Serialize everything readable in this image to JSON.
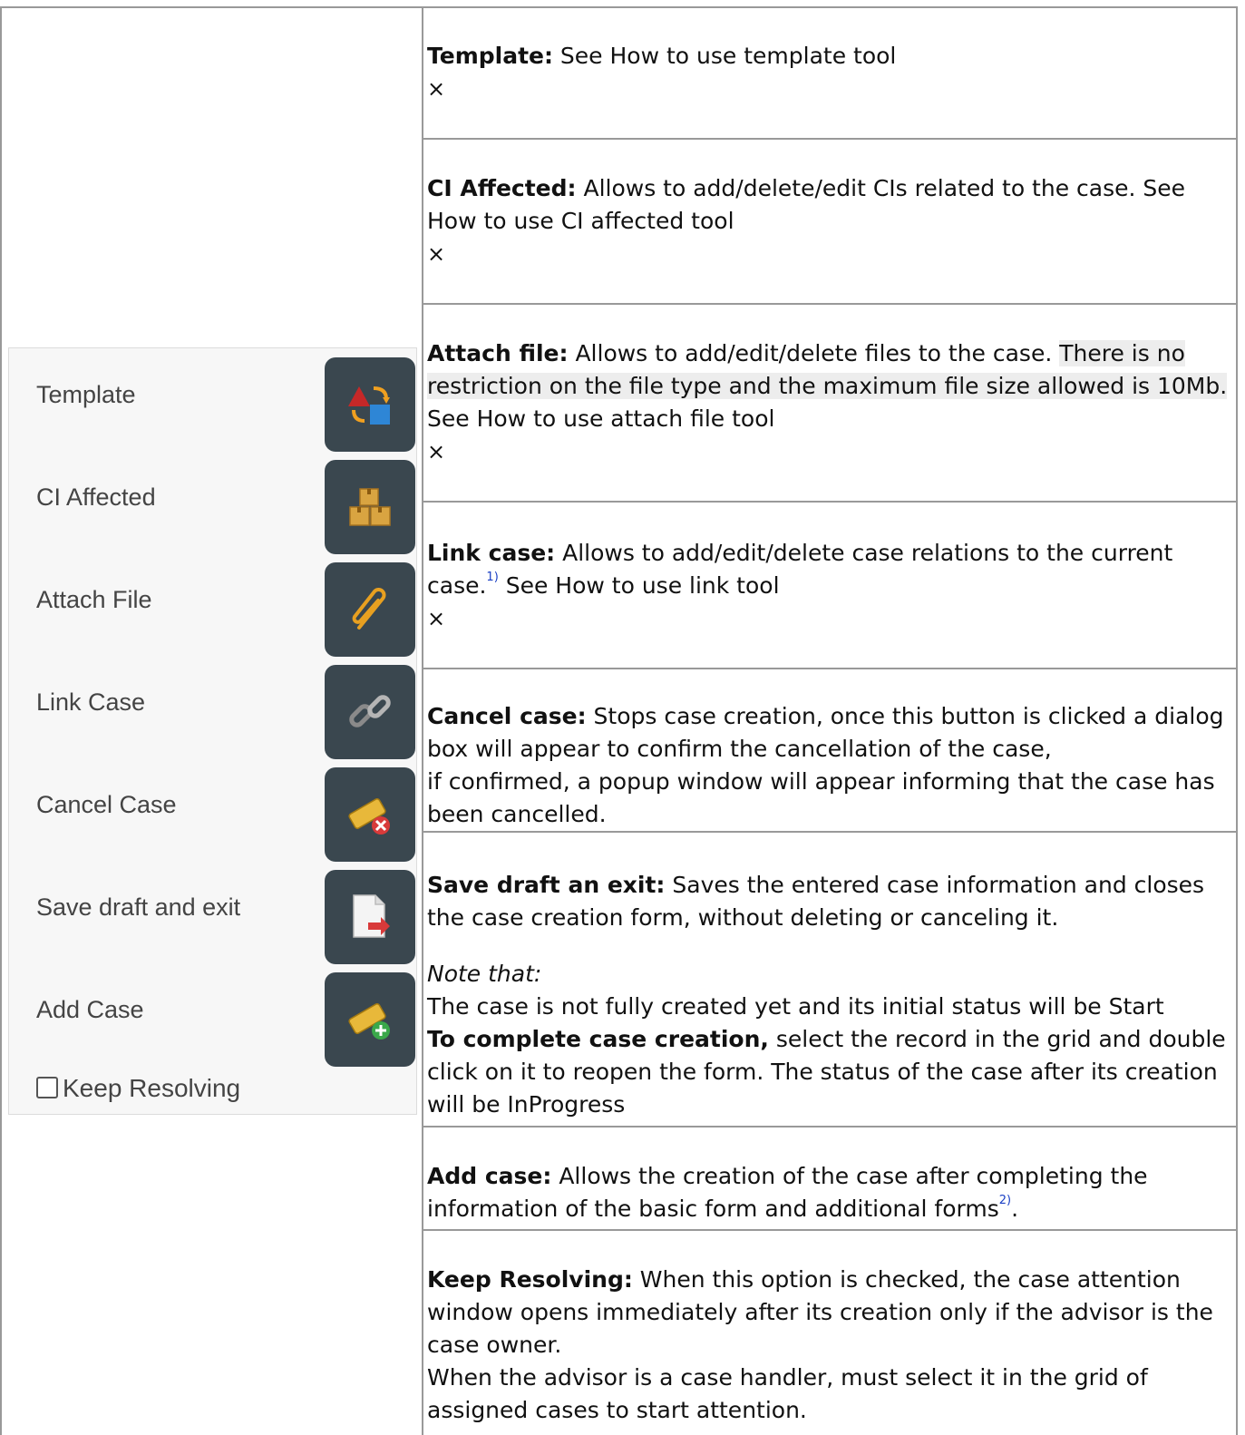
{
  "panel": {
    "items": [
      {
        "label": "Template",
        "icon": "template-icon"
      },
      {
        "label": "CI Affected",
        "icon": "boxes-icon"
      },
      {
        "label": "Attach File",
        "icon": "paperclip-icon"
      },
      {
        "label": "Link Case",
        "icon": "chain-link-icon"
      },
      {
        "label": "Cancel Case",
        "icon": "ticket-cancel-icon"
      },
      {
        "label": "Save draft and exit",
        "icon": "document-exit-icon"
      },
      {
        "label": "Add Case",
        "icon": "ticket-add-icon"
      }
    ],
    "keep_resolving": {
      "label": "Keep Resolving",
      "checked": false
    }
  },
  "rows": {
    "template": {
      "title": "Template:",
      "text": " See How to use template tool",
      "close": "×"
    },
    "ci": {
      "title": "CI Affected:",
      "text": " Allows to add/delete/edit CIs related to the case. See How to use CI affected tool",
      "close": "×"
    },
    "attach": {
      "title": "Attach file:",
      "text1": " Allows to add/edit/delete files to the case. ",
      "text2": "There is no restriction on the file type and the maximum file size allowed is 10Mb.",
      "text3": " See How to use attach file tool",
      "close": "×"
    },
    "link": {
      "title": "Link case:",
      "text1": " Allows to add/edit/delete case relations to the current case.",
      "fn": "1)",
      "text2": " See How to use link tool",
      "close": "×"
    },
    "cancel": {
      "title": "Cancel case:",
      "text": " Stops case creation, once this button is clicked a dialog box will appear to confirm the cancellation of the case,",
      "text2": "if confirmed, a popup window will appear informing that the case has been cancelled."
    },
    "save": {
      "title": "Save draft an exit:",
      "text": " Saves the entered case information and closes the case creation form, without deleting or canceling it.",
      "note": "Note that:",
      "line1": "The case is not fully created yet and its initial status will be Start",
      "bold2": "To complete case creation,",
      "line2": " select the record in the grid and double click on it to reopen the form. The status of the case after its creation will be InProgress"
    },
    "add": {
      "title": "Add case:",
      "text": " Allows the creation of the case after completing the information of the basic form and additional forms",
      "fn": "2)",
      "end": "."
    },
    "keep": {
      "title": "Keep Resolving:",
      "text": " When this option is checked, the case attention window opens immediately after its creation only if the advisor is the case owner.",
      "text2": "When the advisor is a case handler, must select it in the grid of assigned cases to start attention."
    }
  }
}
